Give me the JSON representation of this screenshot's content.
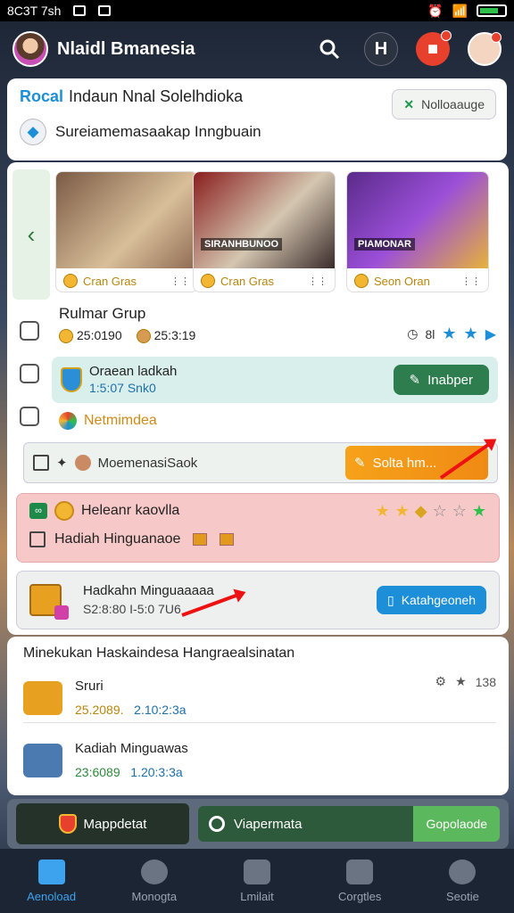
{
  "status": {
    "time": "8C3T 7sh"
  },
  "header": {
    "app_name": "Nlaidl Bmanesia"
  },
  "top": {
    "brand": "Rocal",
    "title": "Indaun Nnal Solelhdioka",
    "action_label": "Nolloaauge",
    "subtitle": "Sureiamemasaakap Inngbuain"
  },
  "carousel": [
    {
      "caption": "Cran Gras",
      "image_text": ""
    },
    {
      "caption": "Cran Gras",
      "image_text": "SIRANHBUNOO"
    },
    {
      "caption": "Seon Oran",
      "image_text": "PIAMONAR"
    }
  ],
  "group": {
    "title": "Rulmar Grup",
    "stat1": "25:0190",
    "stat2": "25:3:19",
    "rating_label": "8l"
  },
  "promo": {
    "title": "Oraean ladkah",
    "number": "1:5:07 Snk0",
    "button": "Inabper"
  },
  "nemo": {
    "label": "Netmimdea"
  },
  "mission": {
    "label": "MoemenasiSaok",
    "button": "Solta hm..."
  },
  "reward": {
    "title": "Heleanr kaovlla",
    "subtitle": "Hadiah Hinguanaoe"
  },
  "chest": {
    "title": "Hadkahn Minguaaaaa",
    "sub": "S2:8:80 I-5:0 7U6",
    "button": "Katahgeoneh"
  },
  "list": {
    "title": "Minekukan Haskaindesa Hangraealsinatan",
    "items": [
      {
        "title": "Sruri",
        "val1": "25.2089.",
        "val2": "2.10:2:3a",
        "meta": "138"
      },
      {
        "title": "Kadiah Minguawas",
        "val1": "23:6089",
        "val2": "1.20:3:3a",
        "meta": ""
      }
    ]
  },
  "actions": {
    "left": "Mappdetat",
    "mid": "Viapermata",
    "go": "Gopolaode"
  },
  "tabs": [
    "Aenoload",
    "Monogta",
    "Lmilait",
    "Corgtles",
    "Seotie"
  ],
  "colors": {
    "accent": "#1d8ed8",
    "green": "#2e7d4f",
    "orange": "#f6a21a",
    "pink": "#f7c8c8"
  }
}
